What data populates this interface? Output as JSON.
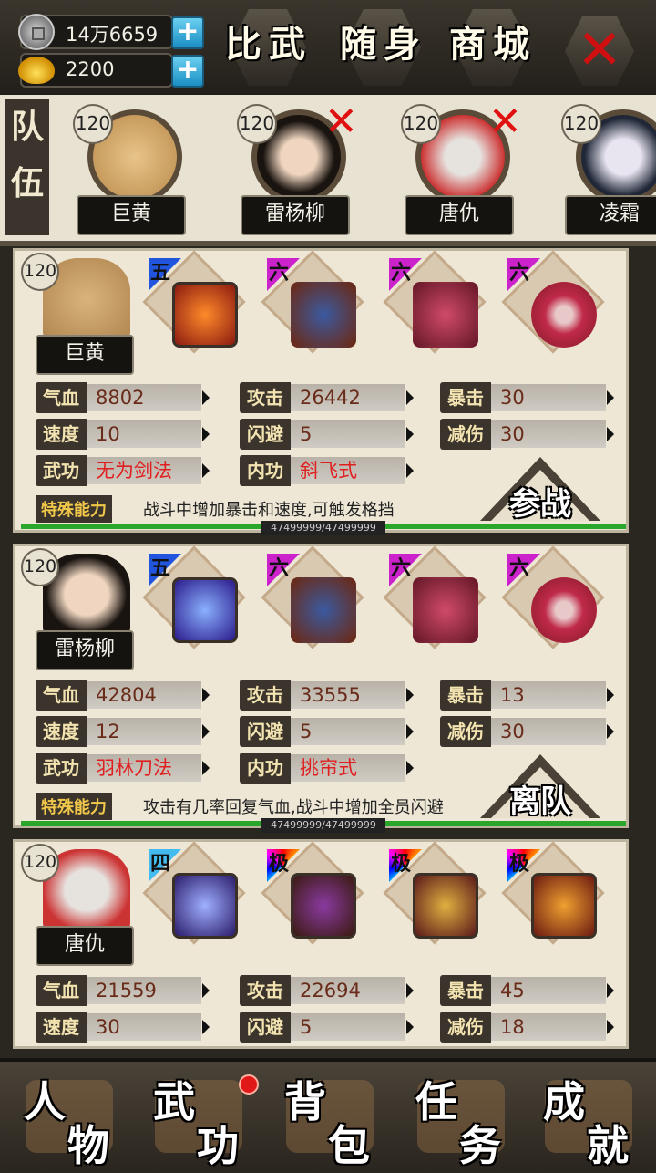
{
  "currency": [
    {
      "icon": "silver-coin-icon",
      "value": "14万6659"
    },
    {
      "icon": "gold-ingot-icon",
      "value": "2200"
    }
  ],
  "top_buttons": {
    "arena": "比武",
    "carry": "随身",
    "shop": "商城"
  },
  "team": {
    "label_1": "队",
    "label_2": "伍",
    "members": [
      {
        "level": "120",
        "name": "巨黄",
        "removable": false
      },
      {
        "level": "120",
        "name": "雷杨柳",
        "removable": true
      },
      {
        "level": "120",
        "name": "唐仇",
        "removable": true
      },
      {
        "level": "120",
        "name": "凌霜",
        "removable": false
      }
    ]
  },
  "cards": [
    {
      "level": "120",
      "name": "巨黄",
      "equipment": [
        {
          "tier": "五",
          "flag_color": "#2255dd",
          "item": "flame-sword-icon"
        },
        {
          "tier": "六",
          "flag_color": "#cc22cc",
          "item": "armor-icon"
        },
        {
          "tier": "六",
          "flag_color": "#cc22cc",
          "item": "boots-icon"
        },
        {
          "tier": "六",
          "flag_color": "#cc22cc",
          "item": "ring-icon"
        }
      ],
      "stats": {
        "hp_label": "气血",
        "hp": "8802",
        "atk_label": "攻击",
        "atk": "26442",
        "crit_label": "暴击",
        "crit": "30",
        "spd_label": "速度",
        "spd": "10",
        "dodge_label": "闪避",
        "dodge": "5",
        "dmgred_label": "减伤",
        "dmgred": "30",
        "skill_label": "武功",
        "skill": "无为剑法",
        "inner_label": "内功",
        "inner": "斜飞式"
      },
      "special_label": "特殊能力",
      "special": "战斗中增加暴击和速度,可触发格挡",
      "action": "参战",
      "hp_text": "47499999/47499999"
    },
    {
      "level": "120",
      "name": "雷杨柳",
      "equipment": [
        {
          "tier": "五",
          "flag_color": "#2255dd",
          "item": "blade-icon"
        },
        {
          "tier": "六",
          "flag_color": "#cc22cc",
          "item": "armor-icon"
        },
        {
          "tier": "六",
          "flag_color": "#cc22cc",
          "item": "boots-icon"
        },
        {
          "tier": "六",
          "flag_color": "#cc22cc",
          "item": "ring-icon"
        }
      ],
      "stats": {
        "hp_label": "气血",
        "hp": "42804",
        "atk_label": "攻击",
        "atk": "33555",
        "crit_label": "暴击",
        "crit": "13",
        "spd_label": "速度",
        "spd": "12",
        "dodge_label": "闪避",
        "dodge": "5",
        "dmgred_label": "减伤",
        "dmgred": "30",
        "skill_label": "武功",
        "skill": "羽林刀法",
        "inner_label": "内功",
        "inner": "挑帘式"
      },
      "special_label": "特殊能力",
      "special": "攻击有几率回复气血,战斗中增加全员闪避",
      "action": "离队",
      "hp_text": "47499999/47499999"
    },
    {
      "level": "120",
      "name": "唐仇",
      "equipment": [
        {
          "tier": "四",
          "flag_color": "#44bbee",
          "item": "sword-icon"
        },
        {
          "tier": "极",
          "flag_color": "rainbow",
          "item": "armor-icon"
        },
        {
          "tier": "极",
          "flag_color": "rainbow",
          "item": "boots-icon"
        },
        {
          "tier": "极",
          "flag_color": "rainbow",
          "item": "token-icon"
        }
      ],
      "stats": {
        "hp_label": "气血",
        "hp": "21559",
        "atk_label": "攻击",
        "atk": "22694",
        "crit_label": "暴击",
        "crit": "45",
        "spd_label": "速度",
        "spd": "30",
        "dodge_label": "闪避",
        "dodge": "5",
        "dmgred_label": "减伤",
        "dmgred": "18"
      }
    }
  ],
  "nav": [
    {
      "l1": "人",
      "l2": "物",
      "icon": "character-icon"
    },
    {
      "l1": "武",
      "l2": "功",
      "icon": "martial-arts-book-icon"
    },
    {
      "l1": "背",
      "l2": "包",
      "icon": "bag-icon"
    },
    {
      "l1": "任",
      "l2": "务",
      "icon": "scroll-icon"
    },
    {
      "l1": "成",
      "l2": "就",
      "icon": "achievement-icon"
    }
  ]
}
